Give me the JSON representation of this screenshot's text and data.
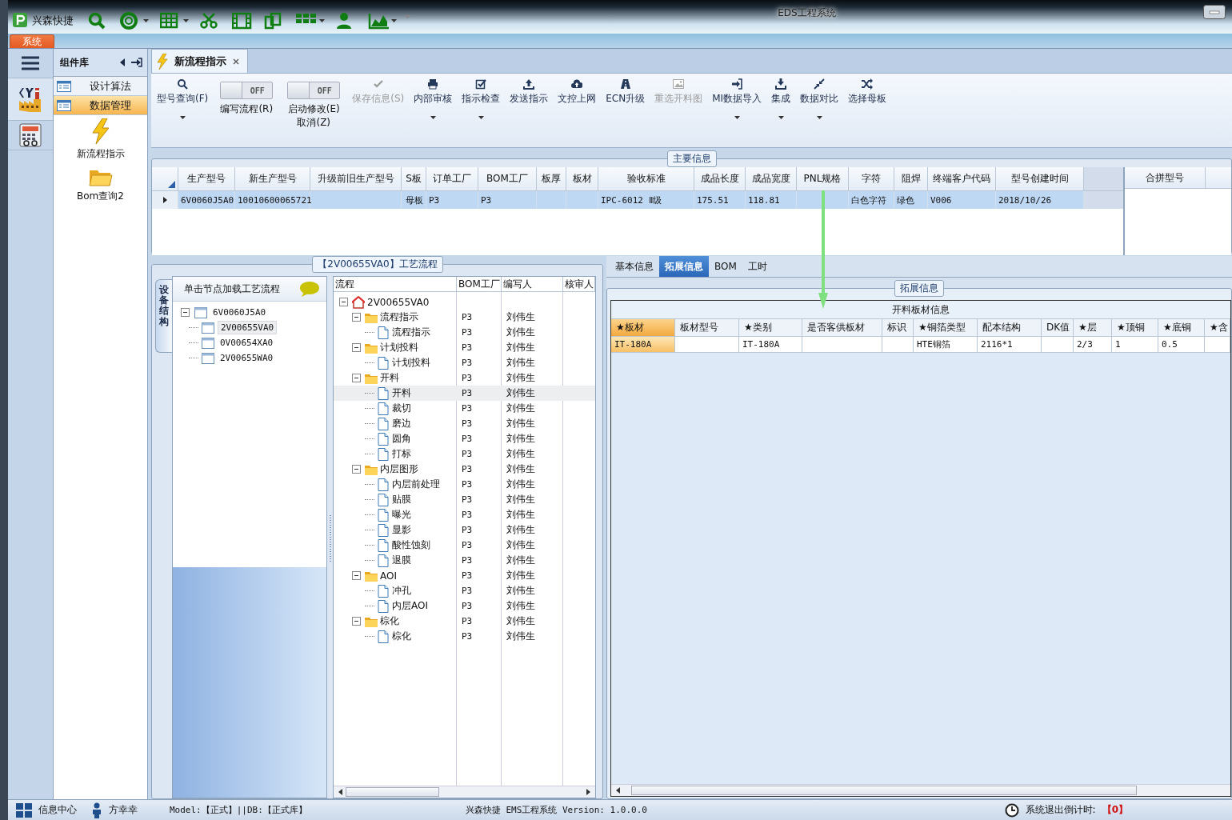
{
  "app": {
    "name": "兴森快捷",
    "title": "EDS工程系统"
  },
  "ribbon_tabs": [
    {
      "label": "系统",
      "selected": true
    }
  ],
  "component_library": {
    "title": "组件库",
    "categories": [
      {
        "label": "设计算法",
        "selected": false
      },
      {
        "label": "数据管理",
        "selected": true
      }
    ],
    "tools": [
      {
        "label": "新流程指示"
      },
      {
        "label": "Bom查询2"
      }
    ]
  },
  "doc_tabs": [
    {
      "label": "新流程指示",
      "selected": true
    }
  ],
  "toolbar": [
    {
      "kind": "button",
      "label": "型号查询(F)",
      "disabled": false,
      "dropdown": true
    },
    {
      "kind": "toggle",
      "label": "编写流程(R)",
      "switch_text": "OFF",
      "on": false
    },
    {
      "kind": "toggle",
      "label": "启动修改(E)\n取消(Z)",
      "switch_text": "OFF",
      "on": false
    },
    {
      "kind": "button",
      "label": "保存信息(S)",
      "disabled": true,
      "dropdown": false
    },
    {
      "kind": "button",
      "label": "内部审核",
      "disabled": false,
      "dropdown": true
    },
    {
      "kind": "button",
      "label": "指示检查",
      "disabled": false,
      "dropdown": true
    },
    {
      "kind": "button",
      "label": "发送指示",
      "disabled": false,
      "dropdown": false
    },
    {
      "kind": "button",
      "label": "文控上网",
      "disabled": false,
      "dropdown": false
    },
    {
      "kind": "button",
      "label": "ECN升级",
      "disabled": false,
      "dropdown": false
    },
    {
      "kind": "button",
      "label": "重选开料图",
      "disabled": true,
      "dropdown": false
    },
    {
      "kind": "button",
      "label": "MI数据导入",
      "disabled": false,
      "dropdown": true
    },
    {
      "kind": "button",
      "label": "集成",
      "disabled": false,
      "dropdown": true
    },
    {
      "kind": "button",
      "label": "数据对比",
      "disabled": false,
      "dropdown": true
    },
    {
      "kind": "button",
      "label": "选择母板",
      "disabled": false,
      "dropdown": false
    }
  ],
  "main_info": {
    "title": "主要信息",
    "columns": [
      "生产型号",
      "新生产型号",
      "升级前旧生产型号",
      "S板",
      "订单工厂",
      "BOM工厂",
      "板厚",
      "板材",
      "验收标准",
      "成品长度",
      "成品宽度",
      "PNL规格",
      "字符",
      "阻焊",
      "终端客户代码",
      "型号创建时间"
    ],
    "rows": [
      {
        "selected": true,
        "cells": [
          "6V0060J5A0",
          "10010600065721",
          "",
          "母板",
          "P3",
          "P3",
          "",
          "",
          "IPC-6012 Ⅱ级",
          "175.51",
          "118.81",
          "",
          "白色字符",
          "绿色",
          "V006",
          "2018/10/26"
        ]
      }
    ],
    "side_columns": [
      "合拼型号"
    ]
  },
  "process": {
    "title": "【2V00655VA0】工艺流程",
    "side_tab": "设备结构",
    "tree_hint": "单击节点加载工艺流程",
    "tree": [
      {
        "label": "6V0060J5A0",
        "expanded": true,
        "selected": false,
        "children": [
          {
            "label": "2V00655VA0",
            "selected": true
          },
          {
            "label": "0V00654XA0",
            "selected": false
          },
          {
            "label": "2V00655WA0",
            "selected": false
          }
        ]
      }
    ],
    "flow_columns": [
      "流程",
      "BOM工厂",
      "编写人",
      "核审人"
    ],
    "flow": [
      {
        "name": "2V00655VA0",
        "expanded": true,
        "selected": false,
        "children": [
          {
            "name": "流程指示",
            "bom": "P3",
            "author": "刘伟生",
            "expanded": true,
            "selected": false,
            "children": [
              {
                "name": "流程指示",
                "bom": "P3",
                "author": "刘伟生",
                "selected": false
              }
            ]
          },
          {
            "name": "计划投料",
            "bom": "P3",
            "author": "刘伟生",
            "expanded": true,
            "selected": false,
            "children": [
              {
                "name": "计划投料",
                "bom": "P3",
                "author": "刘伟生",
                "selected": false
              }
            ]
          },
          {
            "name": "开料",
            "bom": "P3",
            "author": "刘伟生",
            "expanded": true,
            "selected": false,
            "children": [
              {
                "name": "开料",
                "bom": "P3",
                "author": "刘伟生",
                "selected": true
              },
              {
                "name": "裁切",
                "bom": "P3",
                "author": "刘伟生",
                "selected": false
              },
              {
                "name": "磨边",
                "bom": "P3",
                "author": "刘伟生",
                "selected": false
              },
              {
                "name": "圆角",
                "bom": "P3",
                "author": "刘伟生",
                "selected": false
              },
              {
                "name": "打标",
                "bom": "P3",
                "author": "刘伟生",
                "selected": false
              }
            ]
          },
          {
            "name": "内层图形",
            "bom": "P3",
            "author": "刘伟生",
            "expanded": true,
            "selected": false,
            "children": [
              {
                "name": "内层前处理",
                "bom": "P3",
                "author": "刘伟生",
                "selected": false
              },
              {
                "name": "贴膜",
                "bom": "P3",
                "author": "刘伟生",
                "selected": false
              },
              {
                "name": "曝光",
                "bom": "P3",
                "author": "刘伟生",
                "selected": false
              },
              {
                "name": "显影",
                "bom": "P3",
                "author": "刘伟生",
                "selected": false
              },
              {
                "name": "酸性蚀刻",
                "bom": "P3",
                "author": "刘伟生",
                "selected": false
              },
              {
                "name": "退膜",
                "bom": "P3",
                "author": "刘伟生",
                "selected": false
              }
            ]
          },
          {
            "name": "AOI",
            "bom": "P3",
            "author": "刘伟生",
            "expanded": true,
            "selected": false,
            "children": [
              {
                "name": "冲孔",
                "bom": "P3",
                "author": "刘伟生",
                "selected": false
              },
              {
                "name": "内层AOI",
                "bom": "P3",
                "author": "刘伟生",
                "selected": false
              }
            ]
          },
          {
            "name": "棕化",
            "bom": "P3",
            "author": "刘伟生",
            "expanded": true,
            "selected": false,
            "children": [
              {
                "name": "棕化",
                "bom": "P3",
                "author": "刘伟生",
                "selected": false
              }
            ]
          }
        ]
      }
    ]
  },
  "detail": {
    "tabs": [
      {
        "label": "基本信息",
        "selected": false
      },
      {
        "label": "拓展信息",
        "selected": true
      },
      {
        "label": "BOM",
        "selected": false
      },
      {
        "label": "工时",
        "selected": false
      }
    ],
    "group_title": "拓展信息",
    "table_title": "开料板材信息",
    "columns": [
      {
        "label": "★板材",
        "selected": true
      },
      {
        "label": "板材型号",
        "selected": false
      },
      {
        "label": "★类别",
        "selected": false
      },
      {
        "label": "是否客供板材",
        "selected": false
      },
      {
        "label": "标识",
        "selected": false
      },
      {
        "label": "★铜箔类型",
        "selected": false
      },
      {
        "label": "配本结构",
        "selected": false
      },
      {
        "label": "DK值",
        "selected": false
      },
      {
        "label": "★层",
        "selected": false
      },
      {
        "label": "★顶铜",
        "selected": false
      },
      {
        "label": "★底铜",
        "selected": false
      },
      {
        "label": "★含",
        "selected": false
      }
    ],
    "rows": [
      {
        "cells": [
          "IT-180A",
          "",
          "IT-180A",
          "",
          "",
          "HTE铜箔",
          "2116*1",
          "",
          "2/3",
          "1",
          "0.5",
          ""
        ]
      }
    ]
  },
  "status_bar": {
    "items": [
      {
        "label": "信息中心"
      },
      {
        "label": "方幸幸"
      }
    ],
    "connection": "Model:【正式】||DB:【正式库】",
    "version": "兴森快捷 EMS工程系统 Version: 1.0.0.0",
    "countdown_label": "系统退出倒计时:",
    "countdown_value": "【0】"
  }
}
